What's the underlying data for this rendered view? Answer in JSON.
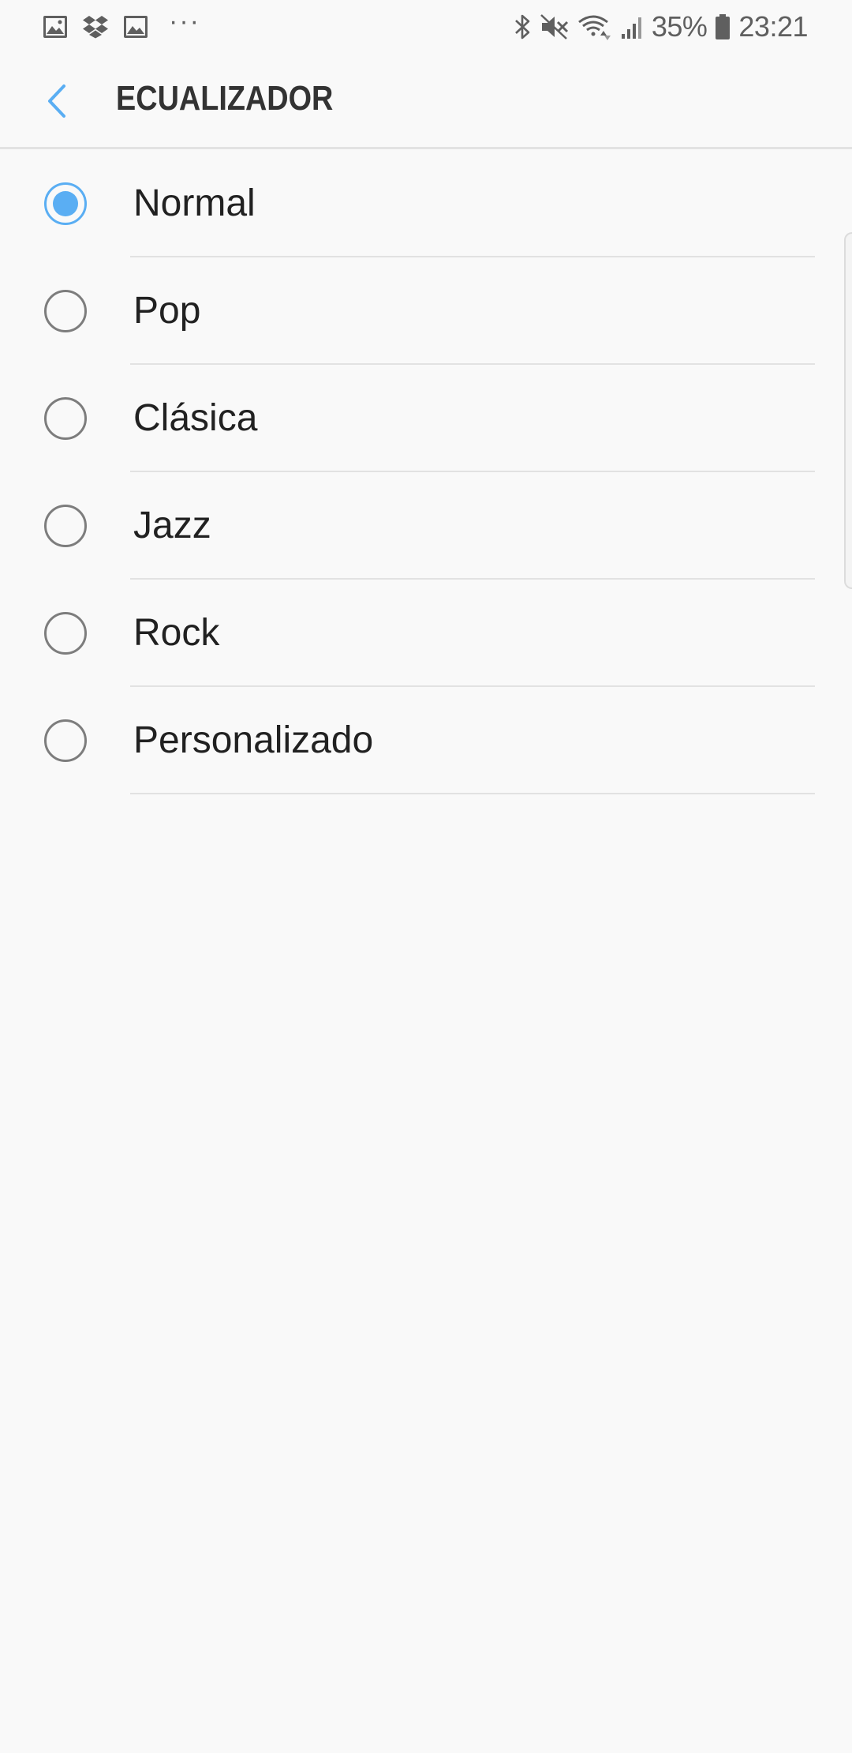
{
  "status_bar": {
    "left_icons": [
      "gallery-icon",
      "dropbox-icon",
      "image-icon"
    ],
    "more_indicator": "···",
    "battery_percent": "35%",
    "time": "23:21",
    "right_icons": [
      "bluetooth-icon",
      "mute-icon",
      "wifi-icon",
      "signal-icon",
      "battery-icon"
    ]
  },
  "app_bar": {
    "back_icon": "chevron-left-icon",
    "title": "ECUALIZADOR"
  },
  "equalizer": {
    "selected": "Normal",
    "options": [
      {
        "label": "Normal",
        "selected": true
      },
      {
        "label": "Pop",
        "selected": false
      },
      {
        "label": "Clásica",
        "selected": false
      },
      {
        "label": "Jazz",
        "selected": false
      },
      {
        "label": "Rock",
        "selected": false
      },
      {
        "label": "Personalizado",
        "selected": false
      }
    ]
  },
  "colors": {
    "accent": "#5aaef3",
    "background": "#f9f9f9",
    "title": "#333333",
    "text": "#212121",
    "radio_unselected": "#7d7d7d",
    "divider": "#e2e2e2"
  }
}
